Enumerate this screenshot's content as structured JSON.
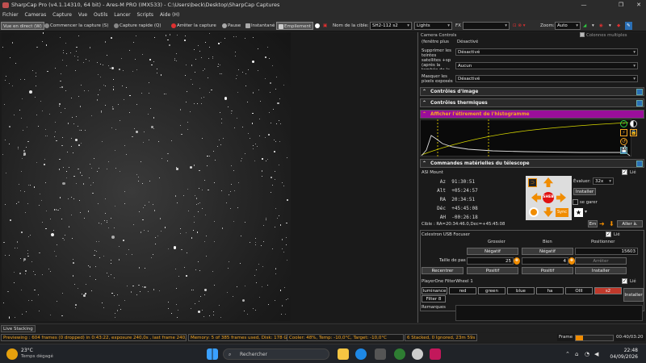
{
  "window": {
    "title": "SharpCap Pro (v4.1.14310, 64 bit) - Ares-M PRO (IMX533) - C:\\Users\\beck\\Desktop\\SharpCap Captures"
  },
  "menu": [
    "Fichier",
    "Cameras",
    "Capture",
    "Vue",
    "Outils",
    "Lancer",
    "Scripts",
    "Aide (H)"
  ],
  "toolbar": {
    "live": "Vue en direct (W)",
    "start_capture": "Commencer la capture (S)",
    "quick_capture": "Capture rapide (Q)",
    "stop_capture": "Arrêter la capture",
    "pause": "Pause",
    "snapshot": "Instantané",
    "stacking": "Empilement",
    "target_label": "Nom de la cible:",
    "target_value": "SH2-112 s2",
    "frame_type": "Lights",
    "fx_label": "FX",
    "zoom_label": "Zoom:",
    "zoom_value": "Auto"
  },
  "panel": {
    "camera_controls": {
      "title": "Camera Controls",
      "multi_columns": "Colonnes multiples",
      "rows": [
        {
          "label": "(fenêtre plus",
          "value": "Désactivé"
        },
        {
          "label": "Supprimer les teintes satellites +sp (après la tombée de la nuit/le ciel)",
          "value": "Désactivé"
        },
        {
          "label": "",
          "value": "Aucun"
        },
        {
          "label": "Masquer les pixels exposés",
          "value": "Désactivé"
        }
      ]
    },
    "image_controls": "Contrôles d'image",
    "thermal_controls": "Contrôles thermiques",
    "histogram": {
      "title": "Afficher l'étirement de l'histogramme"
    },
    "telescope": {
      "title": "Commandes matérielles du télescope",
      "mount": "ASI Mount",
      "linked": "Lié",
      "coords": [
        {
          "k": "Az",
          "v": "91:30:51"
        },
        {
          "k": "Alt",
          "v": "+05:24:57"
        },
        {
          "k": "RA",
          "v": "20:34:51"
        },
        {
          "k": "Déc",
          "v": "+45:45:08"
        },
        {
          "k": "AH",
          "v": "-00:26:18"
        }
      ],
      "slew_label": "Évaluer:",
      "slew_value": "32x",
      "install": "Installer",
      "park": "se garer",
      "center": "SHEB",
      "sync": "Sync",
      "target_text": "Cible : RA=20:34:46.0,Dec=+45:45:08",
      "goto_btn": "Em",
      "go_to": "Aller à."
    },
    "focuser": {
      "title": "Celestron USB Focuser",
      "linked": "Lié",
      "coarse": "Grossier",
      "fine": "Bien",
      "position": "Positionner",
      "negative": "Négatif",
      "position_value": "15603",
      "step_label": "Taille de pas",
      "coarse_step": "25",
      "fine_step": "4",
      "stop": "Arrêter",
      "recenter": "Recentrer",
      "positive": "Positif",
      "install": "Installer"
    },
    "filterwheel": {
      "title": "PlayerOne FilterWheel 1",
      "linked": "Lié",
      "filters": [
        "luminance",
        "red",
        "green",
        "blue",
        "ha",
        "OIII",
        "s2"
      ],
      "filter8": "Filter 8",
      "install": "Installer"
    },
    "remarks": "Remarques"
  },
  "status": {
    "live_stacking": "Live Stacking",
    "previewing": "Previewing : 604 frames (0 dropped) in 0:43:22, exposure 240,0s , last frame 240,0s",
    "memory": "Memory: 5 of 385 frames used, Disk: 178 GB free",
    "cooler": "Cooler: 48%, Temp: -10,0°C, Target: -10,0°C",
    "stacked": "6 Stacked, 0 Ignored, 23m 59s",
    "frame_label": "Frame",
    "frame_time": "00:40/03:20"
  },
  "taskbar": {
    "weather_temp": "23°C",
    "weather_desc": "Temps dégagé",
    "search": "Rechercher",
    "time": "22:48",
    "date": "04/09/2026"
  },
  "colors": {
    "accent_orange": "#f5a623",
    "histogram_header": "#9b0e9b",
    "selected_filter": "#c0392b"
  }
}
